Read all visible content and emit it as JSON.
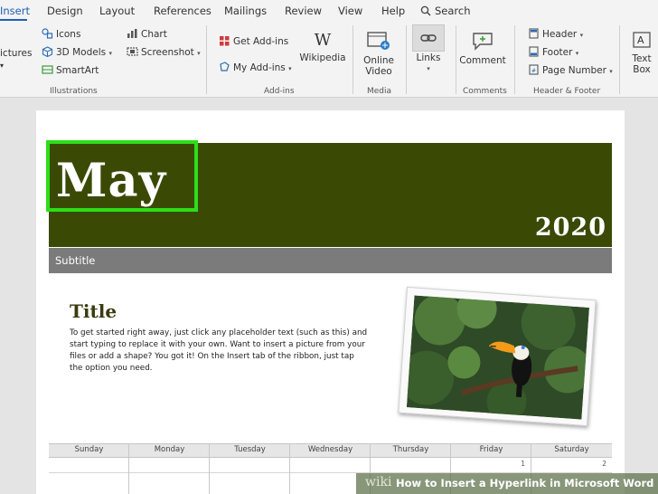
{
  "tabs": [
    "Insert",
    "Design",
    "Layout",
    "References",
    "Mailings",
    "Review",
    "View",
    "Help"
  ],
  "search_label": "Search",
  "ribbon": {
    "illustrations": {
      "pictures_label": "ictures",
      "icons_label": "Icons",
      "models_label": "3D Models",
      "smartart_label": "SmartArt",
      "chart_label": "Chart",
      "screenshot_label": "Screenshot",
      "group_label": "Illustrations"
    },
    "addins": {
      "get_label": "Get Add-ins",
      "my_label": "My Add-ins",
      "wikipedia_label": "Wikipedia",
      "group_label": "Add-ins"
    },
    "media": {
      "video_label_1": "Online",
      "video_label_2": "Video",
      "group_label": "Media"
    },
    "links": {
      "label": "Links"
    },
    "comments": {
      "label": "Comment",
      "group_label": "Comments"
    },
    "header_footer": {
      "header_label": "Header",
      "footer_label": "Footer",
      "page_number_label": "Page Number",
      "group_label": "Header & Footer"
    },
    "text": {
      "label_1": "Text",
      "label_2": "Box"
    }
  },
  "document": {
    "month": "May",
    "year": "2020",
    "subtitle": "Subtitle",
    "title": "Title",
    "body": "To get started right away, just click any placeholder text (such as this) and start typing to replace it with your own. Want to insert a picture from your files or add a shape? You got it! On the Insert tab of the ribbon, just tap the option you need.",
    "calendar": {
      "days": [
        "Sunday",
        "Monday",
        "Tuesday",
        "Wednesday",
        "Thursday",
        "Friday",
        "Saturday"
      ],
      "first_week": [
        "",
        "",
        "",
        "",
        "",
        "1",
        "2"
      ]
    }
  },
  "watermark": {
    "brand": "wiki",
    "text": "How to Insert a Hyperlink in Microsoft Word"
  },
  "colors": {
    "banner": "#3a4a05",
    "selection": "#2dde18",
    "subtitle_bar": "#7b7b7b",
    "accent": "#1f5fb3"
  }
}
